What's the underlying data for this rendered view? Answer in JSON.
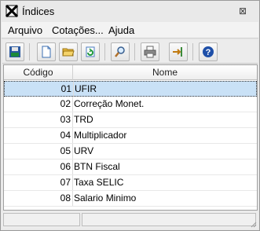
{
  "window": {
    "title": "Índices",
    "close_glyph": "⊠"
  },
  "menu": [
    "Arquivo",
    "Cotações...",
    "Ajuda"
  ],
  "toolbar": {
    "buttons": [
      "save-disk-icon",
      "new-document-icon",
      "open-folder-icon",
      "refresh-icon",
      "search-magnifier-icon",
      "print-icon",
      "import-arrow-icon",
      "help-icon"
    ]
  },
  "grid": {
    "columns": [
      "Código",
      "Nome"
    ],
    "selected_row": 0,
    "rows": [
      {
        "code": "01",
        "name": "UFIR"
      },
      {
        "code": "02",
        "name": "Correção Monet."
      },
      {
        "code": "03",
        "name": "TRD"
      },
      {
        "code": "04",
        "name": "Multiplicador"
      },
      {
        "code": "05",
        "name": "URV"
      },
      {
        "code": "06",
        "name": "BTN Fiscal"
      },
      {
        "code": "07",
        "name": "Taxa SELIC"
      },
      {
        "code": "08",
        "name": "Salario Minimo"
      }
    ]
  },
  "status": {
    "panels": [
      "",
      ""
    ]
  },
  "colors": {
    "selection": "#c9e1f6",
    "window_bg": "#e9e9e9",
    "help_blue": "#1e4fa8"
  }
}
